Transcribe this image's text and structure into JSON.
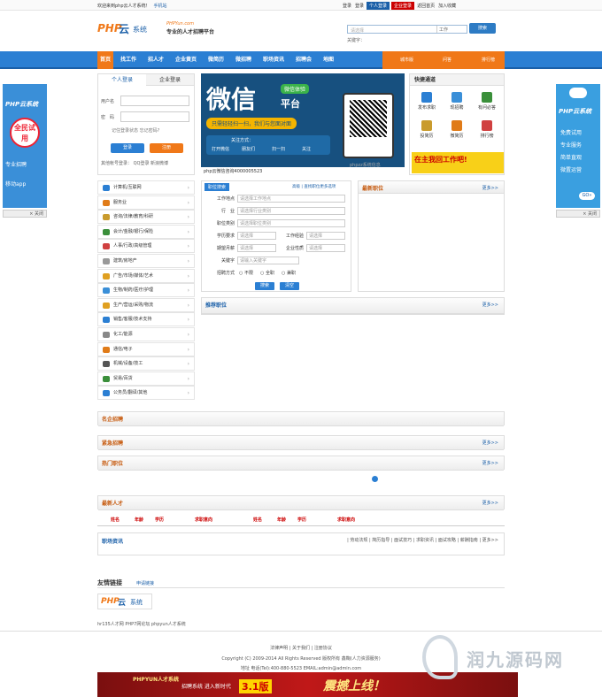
{
  "topbar": {
    "welcome": "欢迎来到php云人才系统！",
    "mobile": "手机站",
    "links": [
      "登录",
      "登录",
      "个人登录",
      "企业登录",
      "返回首页",
      "加入收藏"
    ],
    "colors": {
      "personal": "#1a5fa8",
      "company": "#cc0000"
    }
  },
  "header": {
    "logo_php": "PHP",
    "logo_yun": "云",
    "logo_xt": "系统",
    "url": "PHPYun.com",
    "slogan": "专业的人才招聘平台",
    "search_placeholder": "请选择",
    "search_type": "工作",
    "search_button": "搜索",
    "hot_keywords": "关键字："
  },
  "nav": {
    "items": [
      "首页",
      "找工作",
      "招人才",
      "企业黄页",
      "微简历",
      "微招聘",
      "职场资讯",
      "招聘会",
      "地图"
    ],
    "right": [
      "城市版",
      "问答",
      "排行榜"
    ],
    "colors": {
      "bar": "#2b7fd3",
      "active": "#f07818"
    }
  },
  "left_banner": {
    "title": "PHP云系统",
    "circle": "全民试用",
    "line1": "专业招聘",
    "line2": "移动app",
    "close": "关闭"
  },
  "right_banner": {
    "title": "PHP云系统",
    "lines": [
      "免费试用",
      "专业服务",
      "简单直观",
      "微置运营"
    ],
    "go": "GO»",
    "close": "关闭"
  },
  "login": {
    "tab_personal": "个人登录",
    "tab_company": "企业登录",
    "username": "用户名",
    "password": "密　码",
    "remember": "记住登录状态  忘记密码?",
    "login_btn": "登录",
    "register_btn": "注册",
    "other": "其他帐号登录：  QQ登录  新浪微博"
  },
  "wechat_banner": {
    "title": "微信",
    "tag": "微信体验",
    "sub": "平台",
    "slogan": "只需轻轻扫一扫，我们与您面对面",
    "follow": "关注方式：",
    "steps": [
      "打开微信",
      "朋友们",
      "扫一扫",
      "关注"
    ],
    "watermark": "phpzz系统信息",
    "tel": "php云微信咨询4000005523"
  },
  "quick": {
    "title": "快捷通道",
    "items": [
      "发布求职",
      "现招聘",
      "有问必答",
      "投简历",
      "微简历",
      "排行榜"
    ],
    "ad": "在主我回工作吧!"
  },
  "categories": [
    {
      "label": "计算机/互联网",
      "color": "#2b7fd3"
    },
    {
      "label": "服务业",
      "color": "#e07b18"
    },
    {
      "label": "咨询/法律/教育/科研",
      "color": "#c99b2d"
    },
    {
      "label": "会计/金融/银行/保险",
      "color": "#3a8f3a"
    },
    {
      "label": "人事/行政/高级管理",
      "color": "#d04040"
    },
    {
      "label": "建筑/房地产",
      "color": "#999999"
    },
    {
      "label": "广告/市场/媒体/艺术",
      "color": "#e0a020"
    },
    {
      "label": "生物/制药/医疗/护理",
      "color": "#3a8fd8"
    },
    {
      "label": "生产/营运/采购/物流",
      "color": "#e0a020"
    },
    {
      "label": "销售/客服/技术支持",
      "color": "#2b7fd3"
    },
    {
      "label": "化工/能源",
      "color": "#888888"
    },
    {
      "label": "通信/电子",
      "color": "#e07b18"
    },
    {
      "label": "机械/设备/技工",
      "color": "#555555"
    },
    {
      "label": "贸易/百货",
      "color": "#3a8f3a"
    },
    {
      "label": "公务员/翻译/其他",
      "color": "#2b7fd3"
    }
  ],
  "job_search": {
    "tab": "职位搜索",
    "ad": "高级 | 查找职位更多选项",
    "rows": [
      {
        "label": "工作地点",
        "value": "请选择工作地点"
      },
      {
        "label": "行　业",
        "value": "请选择行业类别"
      },
      {
        "label": "职位类别",
        "value": "请选择职位类别"
      }
    ],
    "edu_label": "学历要求",
    "edu_value": "请选择",
    "exp_label": "工作经验",
    "exp_value": "请选择",
    "salary_label": "期望月薪",
    "salary_value": "请选择",
    "nature_label": "企业性质",
    "nature_value": "请选择",
    "keyword_label": "关键字",
    "keyword_value": "请输入关键字",
    "method_label": "招聘方式",
    "methods": [
      "不限",
      "全职",
      "兼职"
    ],
    "search_btn": "搜索",
    "reset_btn": "清空"
  },
  "panels": {
    "newest": "最新职位",
    "recommend": "推荐职位",
    "famous": "名企招聘",
    "urgent": "紧急招聘",
    "hot": "热门职位",
    "resume": "最新人才",
    "news": "职场资讯",
    "more": "更多>>"
  },
  "resume_cols": [
    "姓名",
    "年龄",
    "学历",
    "求职意向",
    "姓名",
    "年龄",
    "学历",
    "求职意向"
  ],
  "news_links": "| 劳动法规 | 简历指导 | 面试技巧 | 求职资讯 | 面试攻略 | 薪酬指南 | 更多>>",
  "friend": {
    "title": "友情链接",
    "apply": "申请链接",
    "text": "hr135人才网 PHP7网论坛 phpyun人才系统"
  },
  "footer": {
    "links": "法律声明 | 关于我们 | 注册协议",
    "copyright": "Copyright (C) 2009-2014 All Rights Reserved 版权所有 鑫鞠(人力资源服务)",
    "contact": "地址 电话(Tel):400-880-5523 EMAIL:admin@admin.com",
    "banner_s1": "PHPYUN人才系统",
    "banner_s2": "招聘系统  进入新时代",
    "banner_s3": "3.1版",
    "banner_s4": "震撼上线！",
    "watermark": "润九源码网"
  }
}
